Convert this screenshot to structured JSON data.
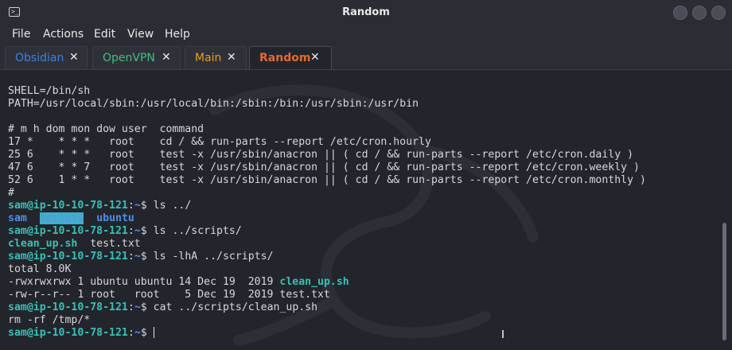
{
  "window": {
    "title": "Random",
    "icon": "terminal-icon"
  },
  "menu": [
    "File",
    "Actions",
    "Edit",
    "View",
    "Help"
  ],
  "tabs": [
    {
      "label": "Obsidian",
      "color": "#3f7fe0"
    },
    {
      "label": "OpenVPN",
      "color": "#3fbf7f"
    },
    {
      "label": "Main",
      "color": "#e0a020"
    },
    {
      "label": "Random",
      "color": "#e26a2c",
      "active": true
    }
  ],
  "prompt": {
    "user_host": "sam@ip-10-10-78-121",
    "sep": ":",
    "path": "~",
    "symbol": "$"
  },
  "terminal": {
    "l1": "SHELL=/bin/sh",
    "l2": "PATH=/usr/local/sbin:/usr/local/bin:/sbin:/bin:/usr/sbin:/usr/bin",
    "l3": "# m h dom mon dow user  command",
    "l4": "17 *    * * *   root    cd / && run-parts --report /etc/cron.hourly",
    "l5": "25 6    * * *   root    test -x /usr/sbin/anacron || ( cd / && run-parts --report /etc/cron.daily )",
    "l6": "47 6    * * 7   root    test -x /usr/sbin/anacron || ( cd / && run-parts --report /etc/cron.weekly )",
    "l7": "52 6    1 * *   root    test -x /usr/sbin/anacron || ( cd / && run-parts --report /etc/cron.monthly )",
    "l8": "#",
    "cmd1": " ls ../",
    "ls1": {
      "sam": "sam",
      "scripts": "scripts",
      "ubuntu": "ubuntu"
    },
    "cmd2": " ls ../scripts/",
    "ls2": {
      "file1": "clean_up.sh",
      "file2": "test.txt"
    },
    "cmd3": " ls -lhA ../scripts/",
    "total": "total 8.0K",
    "row1_prefix": "-rwxrwxrwx 1 ubuntu ubuntu 14 Dec 19  2019 ",
    "row1_file": "clean_up.sh",
    "row2": "-rw-r--r-- 1 root   root    5 Dec 19  2019 test.txt",
    "cmd4": " cat ../scripts/clean_up.sh",
    "cat_out": "rm -rf /tmp/*",
    "cmd5": " "
  },
  "colors": {
    "prompt_user": "#39c0b6",
    "prompt_path": "#5c8df0",
    "dir": "#4f8fe8",
    "exe": "#39c0b6"
  }
}
